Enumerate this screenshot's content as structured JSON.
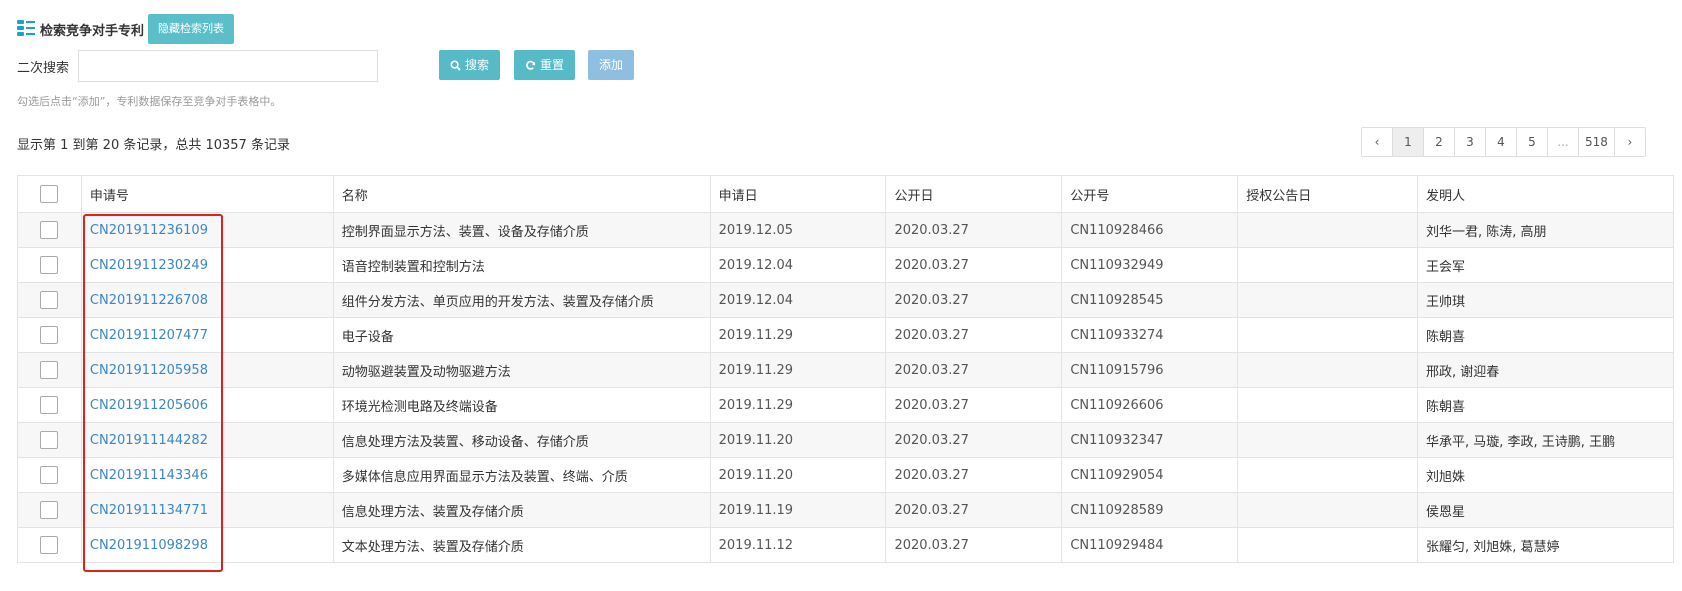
{
  "header": {
    "title": "检索竞争对手专利",
    "hide_button": "隐藏检索列表"
  },
  "search": {
    "label": "二次搜索",
    "input_value": "",
    "search_button": "搜索",
    "reset_button": "重置",
    "add_button": "添加",
    "hint": "勾选后点击“添加”，专利数据保存至竞争对手表格中。"
  },
  "record_info": "显示第 1 到第 20 条记录，总共 10357 条记录",
  "pagination": {
    "prev": "‹",
    "pages": [
      "1",
      "2",
      "3",
      "4",
      "5",
      "...",
      "518"
    ],
    "active": "1",
    "next": "›"
  },
  "table": {
    "columns": [
      "申请号",
      "名称",
      "申请日",
      "公开日",
      "公开号",
      "授权公告日",
      "发明人"
    ],
    "rows": [
      {
        "app_no": "CN201911236109",
        "name": "控制界面显示方法、装置、设备及存储介质",
        "app_date": "2019.12.05",
        "pub_date": "2020.03.27",
        "pub_no": "CN110928466",
        "grant_date": "",
        "inventors": "刘华一君, 陈涛, 高朋"
      },
      {
        "app_no": "CN201911230249",
        "name": "语音控制装置和控制方法",
        "app_date": "2019.12.04",
        "pub_date": "2020.03.27",
        "pub_no": "CN110932949",
        "grant_date": "",
        "inventors": "王会军"
      },
      {
        "app_no": "CN201911226708",
        "name": "组件分发方法、单页应用的开发方法、装置及存储介质",
        "app_date": "2019.12.04",
        "pub_date": "2020.03.27",
        "pub_no": "CN110928545",
        "grant_date": "",
        "inventors": "王帅琪"
      },
      {
        "app_no": "CN201911207477",
        "name": "电子设备",
        "app_date": "2019.11.29",
        "pub_date": "2020.03.27",
        "pub_no": "CN110933274",
        "grant_date": "",
        "inventors": "陈朝喜"
      },
      {
        "app_no": "CN201911205958",
        "name": "动物驱避装置及动物驱避方法",
        "app_date": "2019.11.29",
        "pub_date": "2020.03.27",
        "pub_no": "CN110915796",
        "grant_date": "",
        "inventors": "邢政, 谢迎春"
      },
      {
        "app_no": "CN201911205606",
        "name": "环境光检测电路及终端设备",
        "app_date": "2019.11.29",
        "pub_date": "2020.03.27",
        "pub_no": "CN110926606",
        "grant_date": "",
        "inventors": "陈朝喜"
      },
      {
        "app_no": "CN201911144282",
        "name": "信息处理方法及装置、移动设备、存储介质",
        "app_date": "2019.11.20",
        "pub_date": "2020.03.27",
        "pub_no": "CN110932347",
        "grant_date": "",
        "inventors": "华承平, 马璇, 李政, 王诗鹏, 王鹏"
      },
      {
        "app_no": "CN201911143346",
        "name": "多媒体信息应用界面显示方法及装置、终端、介质",
        "app_date": "2019.11.20",
        "pub_date": "2020.03.27",
        "pub_no": "CN110929054",
        "grant_date": "",
        "inventors": "刘旭姝"
      },
      {
        "app_no": "CN201911134771",
        "name": "信息处理方法、装置及存储介质",
        "app_date": "2019.11.19",
        "pub_date": "2020.03.27",
        "pub_no": "CN110928589",
        "grant_date": "",
        "inventors": "侯恩星"
      },
      {
        "app_no": "CN201911098298",
        "name": "文本处理方法、装置及存储介质",
        "app_date": "2019.11.12",
        "pub_date": "2020.03.27",
        "pub_no": "CN110929484",
        "grant_date": "",
        "inventors": "张耀匀, 刘旭姝, 葛慧婷"
      }
    ]
  },
  "colors": {
    "teal_button": "#56bbc6",
    "add_button": "#8fbfe0",
    "link": "#3a87c8",
    "highlight": "#e0201c"
  }
}
